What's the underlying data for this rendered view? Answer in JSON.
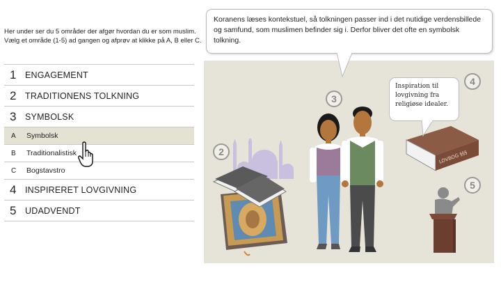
{
  "intro": {
    "line1": "Her under ser du 5 områder der afgør hvordan du er som muslim.",
    "line2": "Vælg et område (1-5) ad gangen og afprøv at klikke på  A, B eller C."
  },
  "menu": [
    {
      "num": "1",
      "label": "ENGAGEMENT"
    },
    {
      "num": "2",
      "label": "TRADITIONENS TOLKNING"
    },
    {
      "num": "3",
      "label": "SYMBOLSK"
    }
  ],
  "sub_options": [
    {
      "num": "A",
      "label": "Symbolsk",
      "selected": true
    },
    {
      "num": "B",
      "label": "Traditionalistisk",
      "selected": false
    },
    {
      "num": "C",
      "label": "Bogstavstro",
      "selected": false
    }
  ],
  "menu_after": [
    {
      "num": "4",
      "label": "INSPIRERET LOVGIVNING"
    },
    {
      "num": "5",
      "label": "UDADVENDT"
    }
  ],
  "speech_bubble": {
    "text": "Koranens læses kontekstuel, så tolkningen passer ind i det nutidige verdensbillede og samfund, som muslimen befinder sig i. Derfor bliver det ofte en symbolsk tolkning."
  },
  "inspiration_bubble": {
    "text": "Inspiration til lovgivning fra religiøse idealer."
  },
  "scene": {
    "markers": [
      "2",
      "3",
      "4",
      "5"
    ],
    "book_spine_text": "LOVBOG §§§",
    "background_color": "#e6e3d9"
  }
}
